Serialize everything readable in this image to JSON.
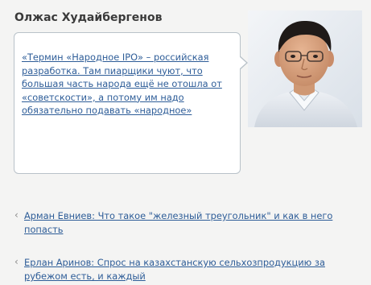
{
  "author": {
    "name": "Олжас Худайбергенов"
  },
  "quote": {
    "text": "«Термин «Народное IPO» – российская разработка. Там пиарщики чуют, что большая часть народа ещё не отошла от «советскости», а потому им надо обязательно подавать «народное»"
  },
  "related": [
    {
      "bullet": "‹",
      "text": "Арман Евниев: Что такое \"железный треугольник\" и как в него попасть"
    },
    {
      "bullet": "‹",
      "text": "Ерлан Аринов: Спрос на казахстанскую сельхозпродукцию за рубежом есть, и каждый"
    }
  ],
  "colors": {
    "background": "#f4f4f3",
    "link": "#2e5d98",
    "bubble_border": "#b9c2c9",
    "name": "#3a3a3a"
  }
}
